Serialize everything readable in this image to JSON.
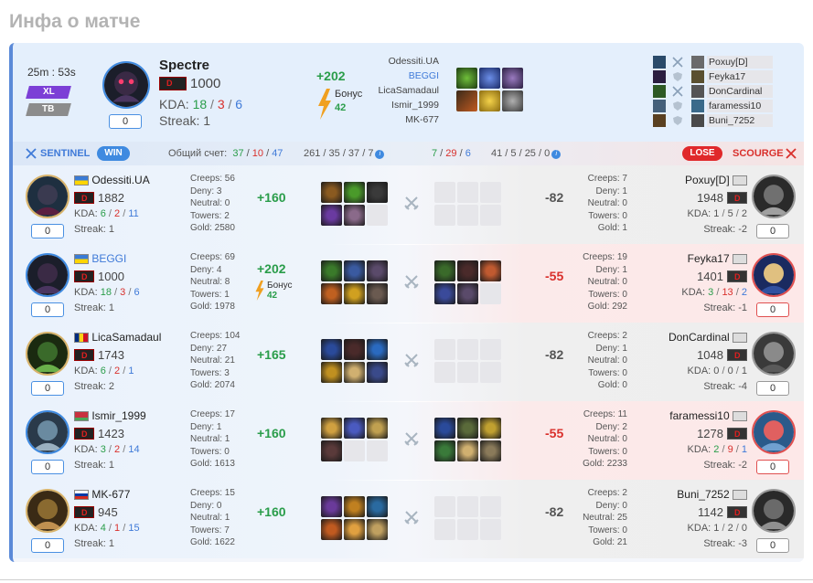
{
  "title": "Инфа о матче",
  "summary": {
    "duration": "25m : 53s",
    "tags": [
      "XL",
      "TB"
    ],
    "player_name": "Spectre",
    "rating": "1000",
    "kda_label": "KDA:",
    "kda": {
      "k": "18",
      "d": "3",
      "a": "6"
    },
    "streak": "Streak: 1",
    "score_box": "0",
    "delta": "+202",
    "bonus_label": "Бонус",
    "bonus_value": "42",
    "mini_players": [
      {
        "left": "Odessiti.UA",
        "right": "Poxuy[D]",
        "left_link": false
      },
      {
        "left": "BEGGI",
        "right": "Feyka17",
        "left_link": true
      },
      {
        "left": "LicaSamadaul",
        "right": "DonCardinal",
        "left_link": false
      },
      {
        "left": "Ismir_1999",
        "right": "faramessi10",
        "left_link": false
      },
      {
        "left": "MK-677",
        "right": "Buni_7252",
        "left_link": false
      }
    ]
  },
  "teambar": {
    "sentinel": "SENTINEL",
    "win": "WIN",
    "total_label": "Общий счет:",
    "sentinel_kda": {
      "k": "37",
      "d": "10",
      "a": "47"
    },
    "sentinel_extra": "261 / 35 / 37 / 7",
    "scourge_kda": {
      "k": "7",
      "d": "29",
      "a": "6"
    },
    "scourge_extra": "41 / 5 / 25 / 0",
    "lose": "LOSE",
    "scourge": "SCOURGE"
  },
  "colors": {
    "accent_blue": "#3f8ae0",
    "win_green": "#2a9d4a",
    "loss_red": "#d9302c"
  },
  "rows": [
    {
      "left": {
        "name": "Odessiti.UA",
        "link": false,
        "flag": "ua",
        "rating": "1882",
        "kda": {
          "k": "6",
          "d": "2",
          "a": "11"
        },
        "streak": "Streak: 1",
        "box": "0",
        "stats": [
          "Creeps: 56",
          "Deny: 3",
          "Neutral: 0",
          "Towers: 2",
          "Gold: 2580"
        ],
        "delta": "+160",
        "bonus": null
      },
      "right": {
        "name": "Poxuy[D]",
        "rating": "1948",
        "kda": {
          "k": "1",
          "d": "5",
          "a": "2"
        },
        "streak": "Streak: -2",
        "box": "0",
        "box_style": "grey",
        "stats": [
          "Creeps: 7",
          "Deny: 1",
          "Neutral: 0",
          "Towers: 0",
          "Gold: 1"
        ],
        "delta": "-82"
      }
    },
    {
      "left": {
        "name": "BEGGI",
        "link": true,
        "flag": "ua",
        "rating": "1000",
        "kda": {
          "k": "18",
          "d": "3",
          "a": "6"
        },
        "streak": "Streak: 1",
        "box": "0",
        "stats": [
          "Creeps: 69",
          "Deny: 4",
          "Neutral: 8",
          "Towers: 1",
          "Gold: 1978"
        ],
        "delta": "+202",
        "bonus": {
          "label": "Бонус",
          "value": "42"
        }
      },
      "right": {
        "name": "Feyka17",
        "rating": "1401",
        "kda": {
          "k": "3",
          "d": "13",
          "a": "2"
        },
        "streak": "Streak: -1",
        "box": "0",
        "box_style": "red",
        "stats": [
          "Creeps: 19",
          "Deny: 1",
          "Neutral: 0",
          "Towers: 0",
          "Gold: 292"
        ],
        "delta": "-55"
      }
    },
    {
      "left": {
        "name": "LicaSamadaul",
        "link": false,
        "flag": "ro",
        "rating": "1743",
        "kda": {
          "k": "6",
          "d": "2",
          "a": "1"
        },
        "streak": "Streak: 2",
        "box": "0",
        "stats": [
          "Creeps: 104",
          "Deny: 27",
          "Neutral: 21",
          "Towers: 3",
          "Gold: 2074"
        ],
        "delta": "+165",
        "bonus": null
      },
      "right": {
        "name": "DonCardinal",
        "rating": "1048",
        "kda": {
          "k": "0",
          "d": "0",
          "a": "1"
        },
        "streak": "Streak: -4",
        "box": "0",
        "box_style": "grey",
        "stats": [
          "Creeps: 2",
          "Deny: 1",
          "Neutral: 0",
          "Towers: 0",
          "Gold: 0"
        ],
        "delta": "-82"
      }
    },
    {
      "left": {
        "name": "Ismir_1999",
        "link": false,
        "flag": "by",
        "rating": "1423",
        "kda": {
          "k": "3",
          "d": "2",
          "a": "14"
        },
        "streak": "Streak: 1",
        "box": "0",
        "stats": [
          "Creeps: 17",
          "Deny: 1",
          "Neutral: 1",
          "Towers: 0",
          "Gold: 1613"
        ],
        "delta": "+160",
        "bonus": null
      },
      "right": {
        "name": "faramessi10",
        "rating": "1278",
        "kda": {
          "k": "2",
          "d": "9",
          "a": "1"
        },
        "streak": "Streak: -2",
        "box": "0",
        "box_style": "red",
        "stats": [
          "Creeps: 11",
          "Deny: 2",
          "Neutral: 0",
          "Towers: 0",
          "Gold: 2233"
        ],
        "delta": "-55"
      }
    },
    {
      "left": {
        "name": "MK-677",
        "link": false,
        "flag": "ru",
        "rating": "945",
        "kda": {
          "k": "4",
          "d": "1",
          "a": "15"
        },
        "streak": "Streak: 1",
        "box": "0",
        "stats": [
          "Creeps: 15",
          "Deny: 0",
          "Neutral: 1",
          "Towers: 7",
          "Gold: 1622"
        ],
        "delta": "+160",
        "bonus": null
      },
      "right": {
        "name": "Buni_7252",
        "rating": "1142",
        "kda": {
          "k": "1",
          "d": "2",
          "a": "0"
        },
        "streak": "Streak: -3",
        "box": "0",
        "box_style": "grey",
        "stats": [
          "Creeps: 2",
          "Deny: 0",
          "Neutral: 25",
          "Towers: 0",
          "Gold: 21"
        ],
        "delta": "-82"
      }
    }
  ]
}
